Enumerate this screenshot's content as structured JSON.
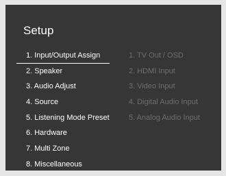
{
  "title": "Setup",
  "main_menu": [
    {
      "label": "1. Input/Output Assign",
      "selected": true
    },
    {
      "label": "2. Speaker"
    },
    {
      "label": "3. Audio Adjust"
    },
    {
      "label": "4. Source"
    },
    {
      "label": "5. Listening Mode Preset"
    },
    {
      "label": "6. Hardware"
    },
    {
      "label": "7. Multi Zone"
    },
    {
      "label": "8. Miscellaneous"
    }
  ],
  "sub_menu": [
    {
      "label": "1. TV Out / OSD"
    },
    {
      "label": "2. HDMI Input"
    },
    {
      "label": "3. Video Input"
    },
    {
      "label": "4. Digital Audio Input"
    },
    {
      "label": "5. Analog Audio Input"
    }
  ],
  "colors": {
    "background": "#363636",
    "text": "#ffffff",
    "inactive_text": "#6e6e6e",
    "frame": "#e6e6e6"
  }
}
